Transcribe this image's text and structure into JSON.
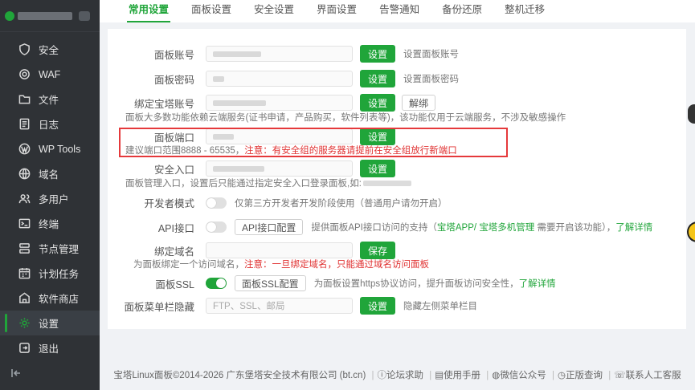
{
  "sidebar": {
    "items": [
      {
        "label": "安全",
        "icon": "shield-icon"
      },
      {
        "label": "WAF",
        "icon": "waf-icon"
      },
      {
        "label": "文件",
        "icon": "folder-icon"
      },
      {
        "label": "日志",
        "icon": "log-icon"
      },
      {
        "label": "WP Tools",
        "icon": "wordpress-icon"
      },
      {
        "label": "域名",
        "icon": "globe-icon"
      },
      {
        "label": "多用户",
        "icon": "users-icon"
      },
      {
        "label": "终端",
        "icon": "terminal-icon"
      },
      {
        "label": "节点管理",
        "icon": "node-icon"
      },
      {
        "label": "计划任务",
        "icon": "schedule-icon"
      },
      {
        "label": "软件商店",
        "icon": "store-icon"
      },
      {
        "label": "设置",
        "icon": "gear-icon",
        "active": true
      },
      {
        "label": "退出",
        "icon": "logout-icon"
      }
    ]
  },
  "tabs": [
    "常用设置",
    "面板设置",
    "安全设置",
    "界面设置",
    "告警通知",
    "备份还原",
    "整机迁移"
  ],
  "form": {
    "account": {
      "label": "面板账号",
      "btn": "设置",
      "hint": "设置面板账号"
    },
    "password": {
      "label": "面板密码",
      "btn": "设置",
      "hint": "设置面板密码"
    },
    "bt_account": {
      "label": "绑定宝塔账号",
      "btn": "设置",
      "btn2": "解绑",
      "sub": "面板大多数功能依赖云端服务(证书申请，产品购买，软件列表等)，该功能仅用于云端服务，不涉及敏感操作"
    },
    "port": {
      "label": "面板端口",
      "btn": "设置",
      "sub": "建议端口范围8888 - 65535，",
      "sub_red": "注意：有安全组的服务器请提前在安全组放行新端口"
    },
    "entry": {
      "label": "安全入口",
      "btn": "设置",
      "sub": "面板管理入口，设置后只能通过指定安全入口登录面板,如:"
    },
    "dev_mode": {
      "label": "开发者模式",
      "hint": "仅第三方开发者开发阶段使用（普通用户请勿开启）"
    },
    "api": {
      "label": "API接口",
      "btn": "API接口配置",
      "hint": "提供面板API接口访问的支持（",
      "link1": "宝塔APP",
      "sep": "/",
      "link2": "宝塔多机管理",
      "hint2": "需要开启该功能），",
      "more": "了解详情"
    },
    "domain": {
      "label": "绑定域名",
      "btn": "保存",
      "sub": "为面板绑定一个访问域名，",
      "sub_red": "注意：一旦绑定域名，只能通过域名访问面板"
    },
    "ssl": {
      "label": "面板SSL",
      "btn": "面板SSL配置",
      "hint": "为面板设置https协议访问，提升面板访问安全性，",
      "more": "了解详情"
    },
    "menu_hide": {
      "label": "面板菜单栏隐藏",
      "placeholder": "FTP、SSL、邮局",
      "btn": "设置",
      "hint": "隐藏左侧菜单栏目"
    }
  },
  "footer": {
    "copyright": "宝塔Linux面板©2014-2026 广东堡塔安全技术有限公司 (bt.cn)",
    "links": [
      "论坛求助",
      "使用手册",
      "微信公众号",
      "正版查询",
      "联系人工客服"
    ]
  },
  "colors": {
    "accent": "#20a53a",
    "sidebar_bg": "#2f3236",
    "warn": "#e03131"
  }
}
